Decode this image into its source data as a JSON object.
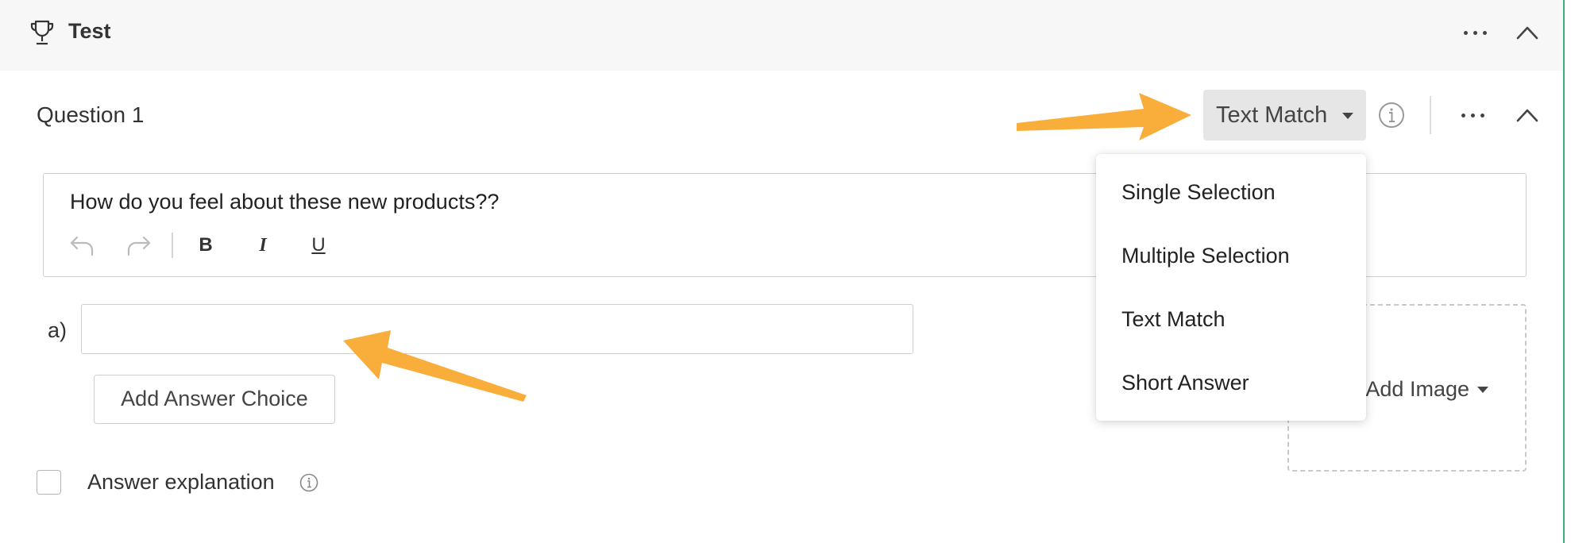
{
  "header": {
    "title": "Test",
    "icon": "trophy-icon"
  },
  "question": {
    "title": "Question 1",
    "type_selected": "Text Match",
    "text": "How do you feel about these new products??",
    "toolbar": {
      "bold": "B",
      "italic": "I",
      "underline": "U"
    }
  },
  "answers": {
    "label": "a)",
    "value": "",
    "add_choice_label": "Add Answer Choice"
  },
  "explanation": {
    "label": "Answer explanation",
    "checked": false
  },
  "image_panel": {
    "label": "Add Image"
  },
  "type_dropdown": {
    "options": [
      "Single Selection",
      "Multiple Selection",
      "Text Match",
      "Short Answer"
    ]
  },
  "colors": {
    "annotation_arrow": "#f9ae3b",
    "right_border": "#3fae7d",
    "header_bg": "#f7f7f7",
    "select_bg": "#e6e6e6"
  }
}
